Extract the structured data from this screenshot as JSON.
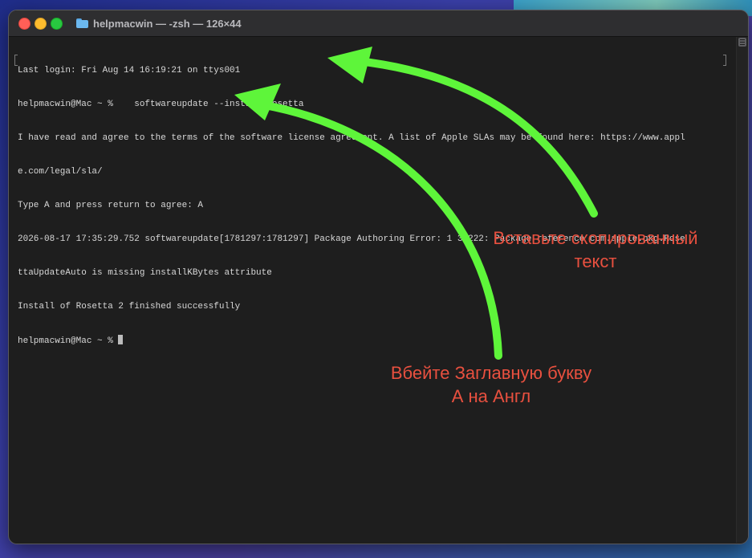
{
  "window": {
    "title": "helpmacwin — -zsh — 126×44"
  },
  "terminal": {
    "lines": [
      "Last login: Fri Aug 14 16:19:21 on ttys001",
      "helpmacwin@Mac ~ %    softwareupdate --install-rosetta",
      "I have read and agree to the terms of the software license agreement. A list of Apple SLAs may be found here: https://www.appl",
      "e.com/legal/sla/",
      "Type A and press return to agree: A",
      "2026-08-17 17:35:29.752 softwareupdate[1781297:1781297] Package Authoring Error: 1 36222: Package reference com.apple.pkg.Rose",
      "ttaUpdateAuto is missing installKBytes attribute",
      "Install of Rosetta 2 finished successfully"
    ],
    "prompt": "helpmacwin@Mac ~ % "
  },
  "annotations": {
    "paste": {
      "line1": "Вставьте скопированный",
      "line2": "текст"
    },
    "letter": {
      "line1": "Вбейте Заглавную букву",
      "line2": "А на Англ"
    }
  },
  "colors": {
    "arrow": "#5ef53a",
    "annotation": "#e8503f",
    "terminal_bg": "#1e1e1e",
    "terminal_text": "#d8d8d8"
  }
}
